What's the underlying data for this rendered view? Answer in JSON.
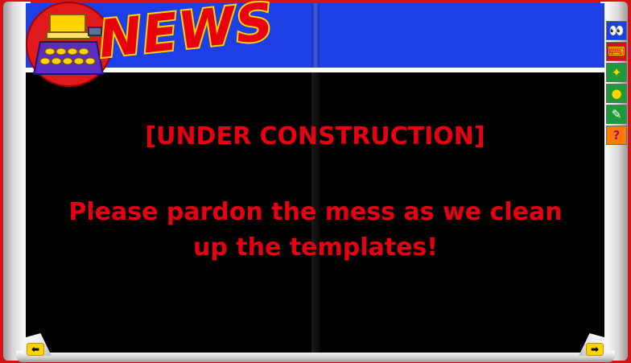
{
  "header": {
    "logo_word": "NEWS"
  },
  "main": {
    "title": "[UNDER CONSTRUCTION]",
    "message": "Please pardon the mess as we clean up the templates!"
  },
  "toolbar": {
    "items": [
      {
        "icon": "eyes-icon",
        "glyph": "👀"
      },
      {
        "icon": "typewriter-icon",
        "glyph": "⌨"
      },
      {
        "icon": "games-icon",
        "glyph": "✦"
      },
      {
        "icon": "chat-bubble-icon",
        "glyph": "●"
      },
      {
        "icon": "poll-icon",
        "glyph": "✎"
      },
      {
        "icon": "help-icon",
        "glyph": "?"
      }
    ]
  },
  "navigation": {
    "prev_icon": "arrow-left-icon",
    "prev_glyph": "⬅",
    "next_icon": "arrow-right-icon",
    "next_glyph": "➡"
  },
  "colors": {
    "frame_red": "#d11414",
    "header_blue": "#1d3fe6",
    "content_black": "#000000",
    "text_red": "#e60012",
    "logo_yellow": "#ffd400"
  }
}
